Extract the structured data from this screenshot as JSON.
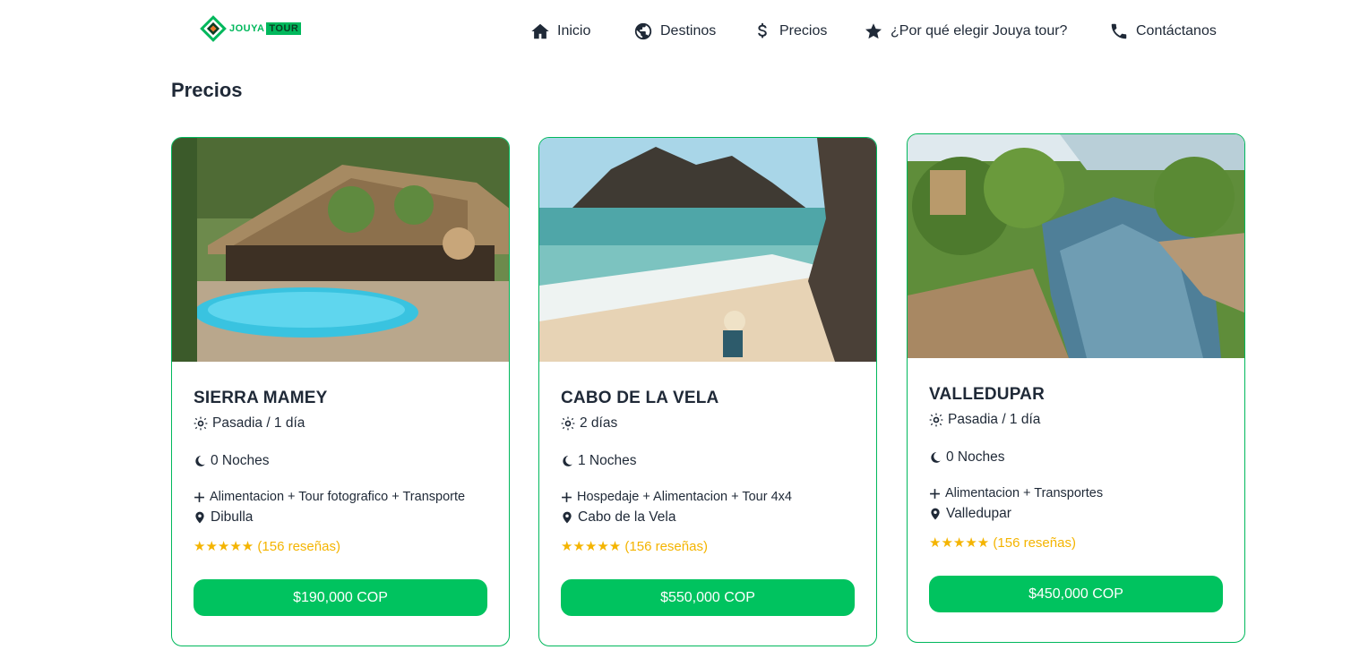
{
  "brand": {
    "word1": "JOUYA",
    "word2": "TOUR"
  },
  "nav": [
    {
      "label": "Inicio",
      "icon": "home-icon"
    },
    {
      "label": "Destinos",
      "icon": "globe-icon"
    },
    {
      "label": "Precios",
      "icon": "dollar-icon"
    },
    {
      "label": "¿Por qué elegir Jouya tour?",
      "icon": "star-icon"
    },
    {
      "label": "Contáctanos",
      "icon": "phone-icon"
    }
  ],
  "section": {
    "title": "Precios"
  },
  "cards": [
    {
      "title": "SIERRA MAMEY",
      "duration": "Pasadia / 1 día",
      "nights": "0 Noches",
      "includes": "Alimentacion + Tour fotografico + Transporte",
      "location": "Dibulla",
      "rating": "★★★★★ (156 reseñas)",
      "price": "$190,000 COP"
    },
    {
      "title": "CABO DE LA VELA",
      "duration": "2 días",
      "nights": "1 Noches",
      "includes": "Hospedaje + Alimentacion + Tour 4x4",
      "location": "Cabo de la Vela",
      "rating": "★★★★★ (156 reseñas)",
      "price": "$550,000 COP"
    },
    {
      "title": "VALLEDUPAR",
      "duration": "Pasadia / 1 día",
      "nights": "0 Noches",
      "includes": "Alimentacion + Transportes",
      "location": "Valledupar",
      "rating": "★★★★★ (156 reseñas)",
      "price": "$450,000 COP"
    }
  ],
  "colors": {
    "accent": "#00c35f",
    "border": "#00b85c",
    "star": "#f4b400",
    "text": "#1f2937"
  }
}
